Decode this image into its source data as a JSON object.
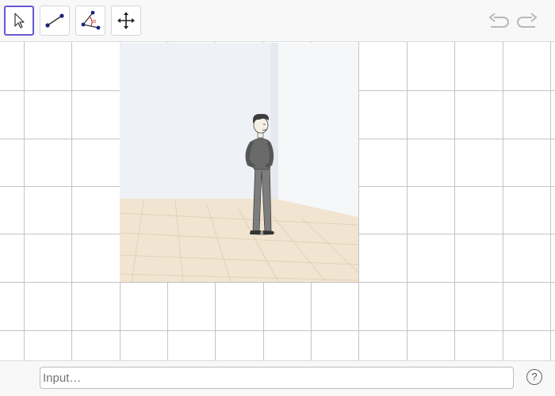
{
  "toolbar": {
    "tools": [
      {
        "name": "move-tool",
        "icon": "cursor-arrow-icon",
        "active": true
      },
      {
        "name": "segment-tool",
        "icon": "segment-icon",
        "active": false
      },
      {
        "name": "angle-tool",
        "icon": "angle-icon",
        "active": false
      },
      {
        "name": "move-graphics-view-tool",
        "icon": "four-way-arrow-icon",
        "active": false
      }
    ],
    "undo_icon": "undo-icon",
    "redo_icon": "redo-icon",
    "active_color": "#6557d2"
  },
  "canvas": {
    "grid": true,
    "grid_color": "#c4c4c4",
    "image": "room-with-standing-man"
  },
  "inputbar": {
    "placeholder": "Input…",
    "help_label": "?"
  }
}
